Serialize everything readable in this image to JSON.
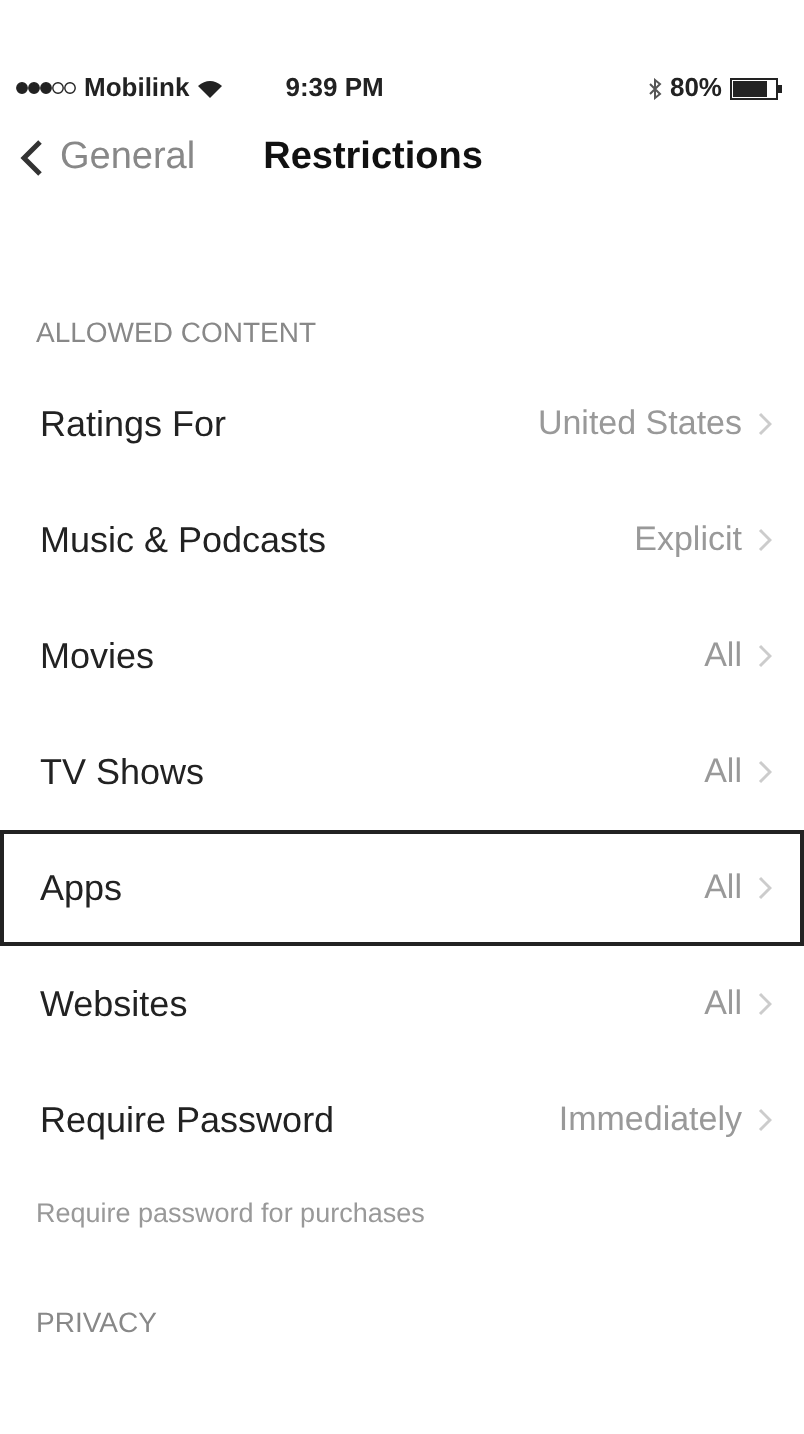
{
  "status_bar": {
    "carrier": "Mobilink",
    "time": "9:39 PM",
    "battery": "80%"
  },
  "nav": {
    "back": "General",
    "title": "Restrictions"
  },
  "sections": [
    {
      "header": "ALLOWED CONTENT",
      "rows": [
        {
          "label": "Ratings For",
          "value": "United States",
          "selected": false
        },
        {
          "label": "Music & Podcasts",
          "value": "Explicit",
          "selected": false
        },
        {
          "label": "Movies",
          "value": "All",
          "selected": false
        },
        {
          "label": "TV Shows",
          "value": "All",
          "selected": false
        },
        {
          "label": "Apps",
          "value": "All",
          "selected": true
        },
        {
          "label": "Websites",
          "value": "All",
          "selected": false
        },
        {
          "label": "Require Password",
          "value": "Immediately",
          "selected": false
        }
      ],
      "footer": "Require password for purchases"
    },
    {
      "header": "PRIVACY"
    }
  ]
}
